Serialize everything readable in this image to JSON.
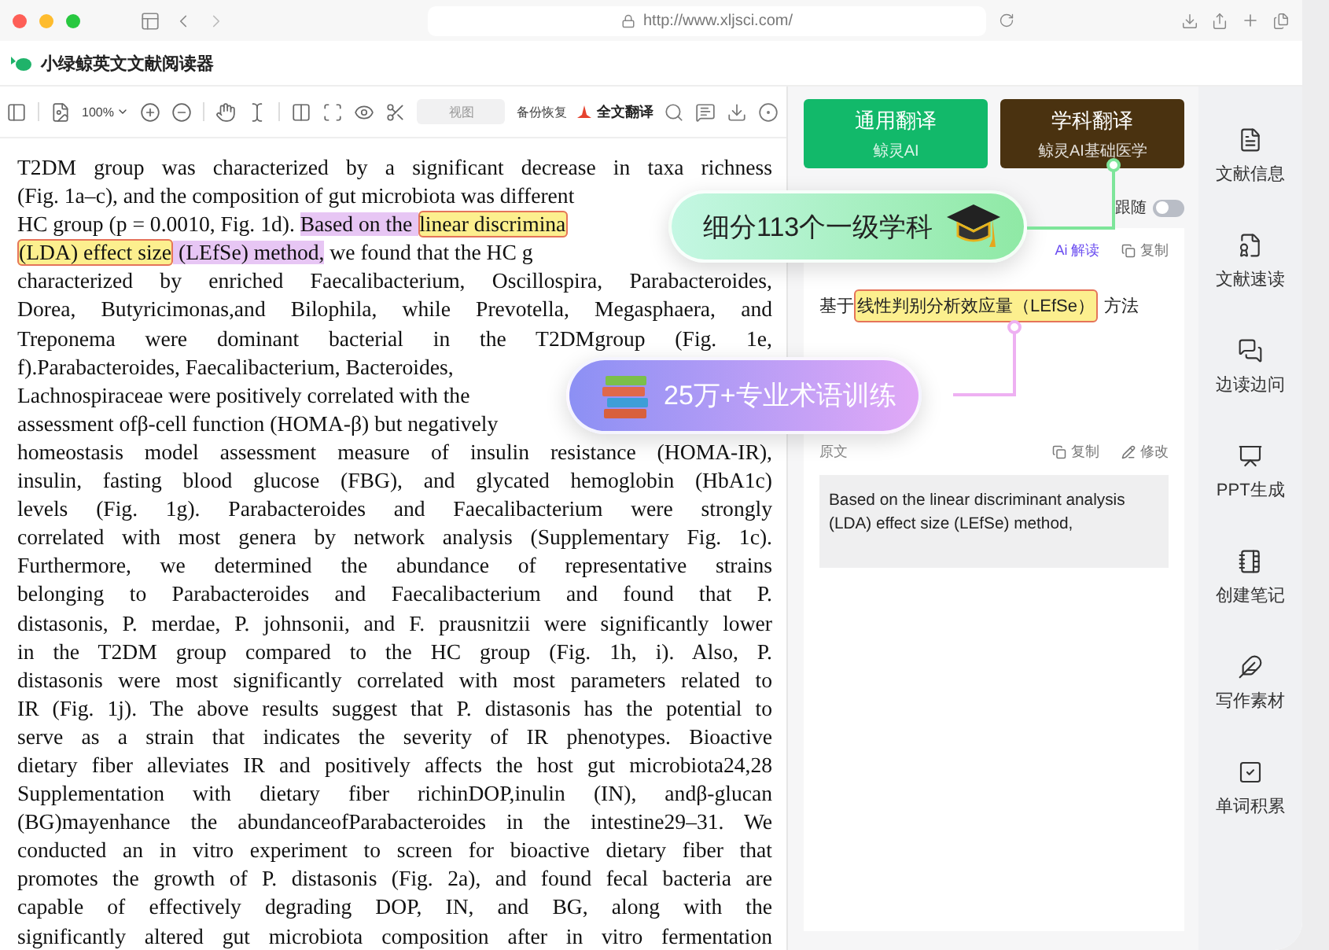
{
  "browser": {
    "url": "http://www.xljsci.com/"
  },
  "app": {
    "title": "小绿鲸英文文献阅读器"
  },
  "toolbar": {
    "zoom": "100%",
    "view": "视图",
    "backup": "备份恢复",
    "translate_all": "全文翻译"
  },
  "document": {
    "lines": [
      {
        "cut": false,
        "segments": [
          {
            "text": "T2DM group was characterized by a significant decrease in taxa richness",
            "kind": "plain"
          }
        ]
      },
      {
        "cut": true,
        "segments": [
          {
            "text": "(Fig. 1a–c), and the composition of gut microbiota was different",
            "kind": "plain"
          }
        ]
      },
      {
        "cut": true,
        "segments": [
          {
            "text": "HC group (p = 0.0010, Fig. 1d). ",
            "kind": "plain"
          },
          {
            "text": "Based on the ",
            "kind": "sentence"
          },
          {
            "text": "linear discrimina",
            "kind": "term"
          }
        ]
      },
      {
        "cut": true,
        "segments": [
          {
            "text": "(LDA) effect size",
            "kind": "term"
          },
          {
            "text": " (LEfSe) method,",
            "kind": "sentence"
          },
          {
            "text": " we found that the HC g",
            "kind": "plain"
          }
        ]
      },
      {
        "cut": false,
        "segments": [
          {
            "text": "characterized by enriched Faecalibacterium, Oscillospira, Parabacteroides,",
            "kind": "plain"
          }
        ]
      },
      {
        "cut": false,
        "segments": [
          {
            "text": "Dorea, Butyricimonas,and Bilophila, while Prevotella, Megasphaera, and",
            "kind": "plain"
          }
        ]
      },
      {
        "cut": false,
        "segments": [
          {
            "text": "Treponema were dominant bacterial in the T2DMgroup (Fig. 1e,",
            "kind": "plain"
          }
        ]
      },
      {
        "cut": true,
        "segments": [
          {
            "text": "f).Parabacteroides, Faecalibacterium, Bacteroides,",
            "kind": "plain"
          }
        ]
      },
      {
        "cut": true,
        "segments": [
          {
            "text": "Lachnospiraceae were positively correlated with the",
            "kind": "plain"
          }
        ]
      },
      {
        "cut": true,
        "segments": [
          {
            "text": "assessment ofβ-cell function (HOMA-β) but negatively",
            "kind": "plain"
          }
        ]
      },
      {
        "cut": false,
        "segments": [
          {
            "text": "homeostasis model assessment measure of insulin resistance (HOMA-IR),",
            "kind": "plain"
          }
        ]
      },
      {
        "cut": false,
        "segments": [
          {
            "text": "insulin, fasting blood glucose (FBG), and glycated hemoglobin (HbA1c)",
            "kind": "plain"
          }
        ]
      },
      {
        "cut": false,
        "segments": [
          {
            "text": "levels (Fig. 1g). Parabacteroides and Faecalibacterium were strongly",
            "kind": "plain"
          }
        ]
      },
      {
        "cut": false,
        "segments": [
          {
            "text": "correlated with most genera by network analysis (Supplementary Fig. 1c).",
            "kind": "plain"
          }
        ]
      },
      {
        "cut": false,
        "segments": [
          {
            "text": "Furthermore, we determined the abundance of representative strains",
            "kind": "plain"
          }
        ]
      },
      {
        "cut": false,
        "segments": [
          {
            "text": "belonging to Parabacteroides and Faecalibacterium and found that P.",
            "kind": "plain"
          }
        ]
      },
      {
        "cut": false,
        "segments": [
          {
            "text": "distasonis, P. merdae, P. johnsonii, and F. prausnitzii were significantly lower",
            "kind": "plain"
          }
        ]
      },
      {
        "cut": false,
        "segments": [
          {
            "text": "in the T2DM group compared to the HC group (Fig. 1h, i). Also, P.",
            "kind": "plain"
          }
        ]
      },
      {
        "cut": false,
        "segments": [
          {
            "text": "distasonis were most significantly correlated with most parameters related to",
            "kind": "plain"
          }
        ]
      },
      {
        "cut": false,
        "segments": [
          {
            "text": "IR (Fig. 1j). The above results suggest that P. distasonis has the potential to",
            "kind": "plain"
          }
        ]
      },
      {
        "cut": false,
        "segments": [
          {
            "text": "serve as a strain that indicates the severity of IR phenotypes. Bioactive",
            "kind": "plain"
          }
        ]
      },
      {
        "cut": false,
        "segments": [
          {
            "text": "dietary fiber alleviates IR and positively affects the host gut microbiota24,28",
            "kind": "plain"
          }
        ]
      },
      {
        "cut": false,
        "segments": [
          {
            "text": "Supplementation with dietary fiber richinDOP,inulin (IN), andβ-glucan",
            "kind": "plain"
          }
        ]
      },
      {
        "cut": false,
        "segments": [
          {
            "text": "(BG)mayenhance the abundanceofParabacteroides in the intestine29–31. We",
            "kind": "plain"
          }
        ]
      },
      {
        "cut": false,
        "segments": [
          {
            "text": "conducted an in vitro experiment to screen for bioactive dietary fiber that",
            "kind": "plain"
          }
        ]
      },
      {
        "cut": false,
        "segments": [
          {
            "text": "promotes the growth of P. distasonis (Fig. 2a), and found fecal bacteria are",
            "kind": "plain"
          }
        ]
      },
      {
        "cut": false,
        "segments": [
          {
            "text": "capable of effectively degrading DOP, IN, and BG, along with the",
            "kind": "plain"
          }
        ]
      },
      {
        "cut": false,
        "segments": [
          {
            "text": "significantly altered gut microbiota composition after in vitro fermentation",
            "kind": "plain"
          }
        ]
      }
    ]
  },
  "promos": [
    {
      "text": "细分113个一级学科",
      "kind": "cap"
    },
    {
      "text": "25万+专业术语训练",
      "kind": "books"
    }
  ],
  "translation": {
    "modes": [
      {
        "title": "通用翻译",
        "subtitle": "鲸灵AI",
        "color": "#12b96a"
      },
      {
        "title": "学科翻译",
        "subtitle": "鲸灵AI基础医学",
        "color": "#4a3210"
      }
    ],
    "follow": {
      "label": "跟随",
      "on": false
    },
    "result_actions": [
      {
        "label": "Ai 解读",
        "kind": "ai"
      },
      {
        "label": "复制",
        "kind": "copy"
      }
    ],
    "result": {
      "before": "基于",
      "term": "线性判别分析效应量（LEfSe）",
      "after": "方法"
    },
    "source_label": "原文",
    "source_actions": [
      {
        "label": "复制",
        "kind": "copy"
      },
      {
        "label": "修改",
        "kind": "edit"
      }
    ],
    "source_text": "Based on the linear discriminant analysis (LDA) effect size (LEfSe) method,"
  },
  "sidebar": [
    "文献信息",
    "文献速读",
    "边读边问",
    "PPT生成",
    "创建笔记",
    "写作素材",
    "单词积累"
  ]
}
